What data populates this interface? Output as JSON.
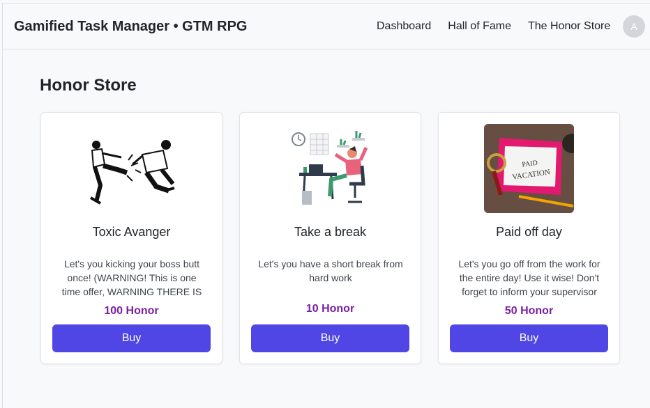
{
  "navbar": {
    "brand": "Gamified Task Manager • GTM RPG",
    "links": [
      "Dashboard",
      "Hall of Fame",
      "The Honor Store"
    ],
    "avatar_letter": "A"
  },
  "page": {
    "title": "Honor Store"
  },
  "store": {
    "items": [
      {
        "title": "Toxic Avanger",
        "description": "Let's you kicking your boss butt once! (WARNING! This is one time offer, WARNING THERE IS NO...",
        "price": "100 Honor",
        "button": "Buy"
      },
      {
        "title": "Take a break",
        "description": "Let's you have a short break from hard work",
        "price": "10 Honor",
        "button": "Buy"
      },
      {
        "title": "Paid off day",
        "description": "Let's you go off from the work for the entire day! Use it wise! Don't forget to inform your supervisor i...",
        "price": "50 Honor",
        "button": "Buy"
      }
    ],
    "note_text": "PAID VACATION"
  },
  "colors": {
    "accent": "#4f46e5",
    "price": "#7b1fa2",
    "navbar_bg": "#f8f9fa",
    "page_bg": "#f8f9fb"
  }
}
